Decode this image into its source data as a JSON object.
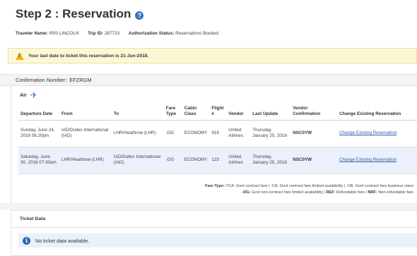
{
  "page": {
    "title": "Step 2 : Reservation"
  },
  "trip": {
    "traveler_label": "Traveler Name:",
    "traveler_value": "IRIS LINCOLN",
    "trip_id_label": "Trip ID:",
    "trip_id_value": "287723",
    "auth_label": "Authorization Status:",
    "auth_value": "Reservations Booked"
  },
  "alert": {
    "text": "Your last date to ticket this reservation is 21-Jun-2018."
  },
  "confirmation": {
    "label": "Confirmation Number:",
    "value": "EFZRGM"
  },
  "air": {
    "heading": "Air",
    "columns": [
      "Departure Date",
      "From",
      "To",
      "Fare Type",
      "Cabin Class",
      "Flight #",
      "Vendor",
      "Last Update",
      "Vendor Confirmation",
      "Change Existing Reservation"
    ],
    "rows": [
      {
        "departure": "Sunday, June 24, 2018 06:20pm",
        "from": "IAD/Dulles International (IAD)",
        "to": "LHR/Heathrow (LHR)",
        "fare_type": "-DG",
        "cabin": "ECONOMY",
        "flight": "918",
        "vendor": "United Airlines",
        "last_update": "Thursday, January 25, 2018",
        "vendor_conf": "NSC0YW",
        "change": "Change Existing Reservation"
      },
      {
        "departure": "Saturday, June 30, 2018 07:30am",
        "from": "LHR/Heathrow (LHR)",
        "to": "IAD/Dulles International (IAD)",
        "fare_type": "-DG",
        "cabin": "ECONOMY",
        "flight": "123",
        "vendor": "United Airlines",
        "last_update": "Thursday, January 25, 2018",
        "vendor_conf": "NSC0YW",
        "change": "Change Existing Reservation"
      }
    ],
    "legend": {
      "label": "Fare Type:",
      "line1": "YCA: Govt contract fare  |  -CA: Govt contract fare limited availability  |  -CB: Govt contract fare business class",
      "line2_dg": "-DG:",
      "line2_dg_text": "Govt non-contract fare limited availability",
      "line2_ref": "REF:",
      "line2_ref_text": "Refundable fare",
      "line2_nrf": "NRF:",
      "line2_nrf_text": "Non-refundable fare"
    }
  },
  "ticket": {
    "heading": "Ticket Data",
    "message": "No ticket data available."
  },
  "icons": {
    "help": "help-icon",
    "warning": "warning-icon",
    "plane": "plane-icon",
    "info": "info-icon"
  },
  "colors": {
    "accent": "#3a74c4",
    "alert_bg": "#fcf8d6",
    "row_alt": "#eaf1fa",
    "link": "#2a5ea8"
  }
}
